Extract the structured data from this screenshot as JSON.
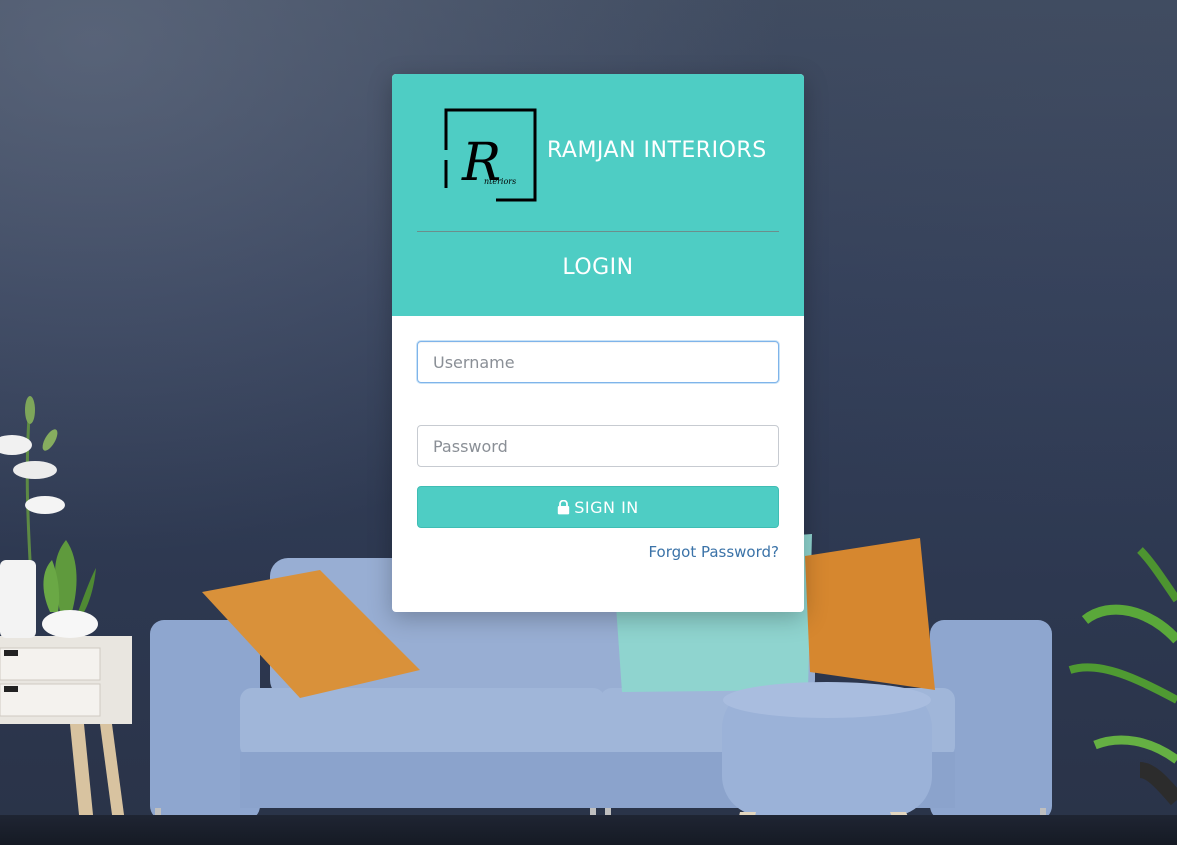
{
  "brand": {
    "name": "RAMJAN INTERIORS",
    "logo_letter": "R",
    "logo_subtext": "nteriors"
  },
  "login": {
    "title": "LOGIN",
    "username_placeholder": "Username",
    "password_placeholder": "Password",
    "signin_label": "SIGN IN",
    "forgot_label": "Forgot Password?"
  },
  "colors": {
    "accent": "#4ecdc4",
    "link": "#3b73a8",
    "background": "#34405a"
  },
  "icons": {
    "signin": "lock-icon"
  }
}
